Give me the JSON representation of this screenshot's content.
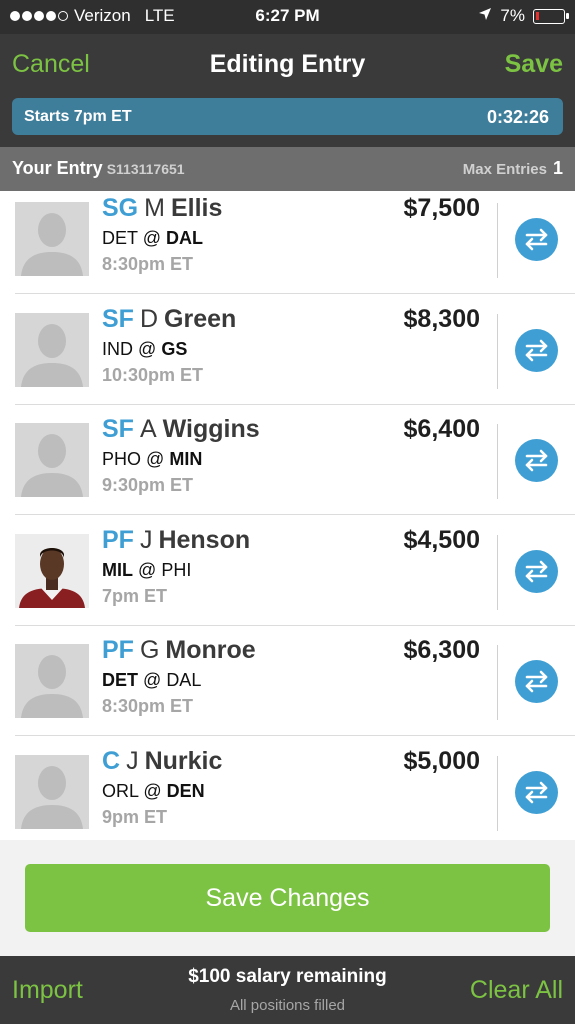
{
  "status_bar": {
    "carrier": "Verizon",
    "network": "LTE",
    "time": "6:27 PM",
    "battery": "7%",
    "location_icon": "location-arrow-icon",
    "battery_level": 0.07,
    "signal_bars": 4,
    "signal_total": 5
  },
  "nav": {
    "cancel_label": "Cancel",
    "title": "Editing Entry",
    "save_label": "Save"
  },
  "contest": {
    "starts_label": "Starts 7pm ET",
    "countdown": "0:32:26"
  },
  "entry": {
    "label": "Your Entry",
    "id": "S113117651",
    "max_entries_label": "Max Entries",
    "max_entries_value": "1"
  },
  "players": [
    {
      "pos": "SG",
      "first": "M",
      "last": "Ellis",
      "salary": "$7,500",
      "away": "DET",
      "home": "DAL",
      "bold": "home",
      "time": "8:30pm ET",
      "photo": false
    },
    {
      "pos": "SF",
      "first": "D",
      "last": "Green",
      "salary": "$8,300",
      "away": "IND",
      "home": "GS",
      "bold": "home",
      "time": "10:30pm ET",
      "photo": false
    },
    {
      "pos": "SF",
      "first": "A",
      "last": "Wiggins",
      "salary": "$6,400",
      "away": "PHO",
      "home": "MIN",
      "bold": "home",
      "time": "9:30pm ET",
      "photo": false
    },
    {
      "pos": "PF",
      "first": "J",
      "last": "Henson",
      "salary": "$4,500",
      "away": "MIL",
      "home": "PHI",
      "bold": "away",
      "time": "7pm ET",
      "photo": true
    },
    {
      "pos": "PF",
      "first": "G",
      "last": "Monroe",
      "salary": "$6,300",
      "away": "DET",
      "home": "DAL",
      "bold": "away",
      "time": "8:30pm ET",
      "photo": false
    },
    {
      "pos": "C",
      "first": "J",
      "last": "Nurkic",
      "salary": "$5,000",
      "away": "ORL",
      "home": "DEN",
      "bold": "home",
      "time": "9pm ET",
      "photo": false
    }
  ],
  "at_symbol": "@",
  "actions": {
    "save_changes_label": "Save Changes",
    "import_label": "Import",
    "clear_all_label": "Clear All",
    "salary_remaining": "$100 salary remaining",
    "positions_status": "All positions filled"
  },
  "colors": {
    "accent_green": "#7cc243",
    "position_blue": "#3f9fd4",
    "banner_blue": "#3f7e9b",
    "bar_dark": "#3a3a3a",
    "battery_red": "#e0322e"
  }
}
